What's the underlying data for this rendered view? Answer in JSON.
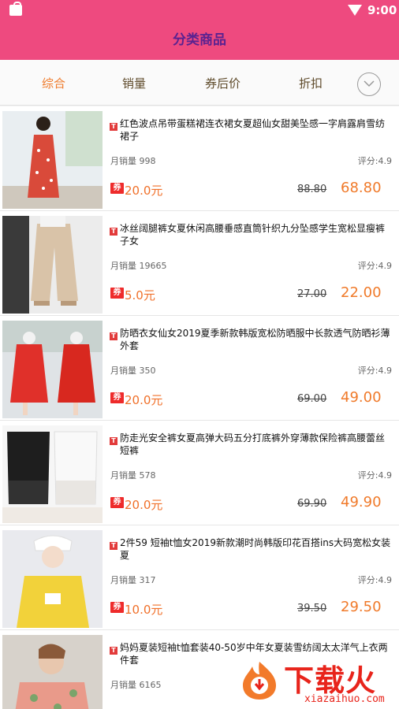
{
  "status_bar": {
    "time": "9:00"
  },
  "header": {
    "title": "分类商品"
  },
  "tabs": [
    {
      "label": "综合",
      "active": true
    },
    {
      "label": "销量",
      "active": false
    },
    {
      "label": "券后价",
      "active": false
    },
    {
      "label": "折扣",
      "active": false
    }
  ],
  "products": [
    {
      "name": "红色波点吊带蛋糕裙连衣裙女夏超仙女甜美坠感一字肩露肩雪纺裙子",
      "sales": "月销量 998",
      "rating": "评分:4.9",
      "coupon": "20.0元",
      "original_price": "88.80",
      "final_price": "68.80"
    },
    {
      "name": "冰丝阔腿裤女夏休闲高腰垂感直筒针织九分坠感学生宽松显瘦裤子女",
      "sales": "月销量 19665",
      "rating": "评分:4.9",
      "coupon": "5.0元",
      "original_price": "27.00",
      "final_price": "22.00"
    },
    {
      "name": "防晒衣女仙女2019夏季新款韩版宽松防晒服中长款透气防晒衫薄外套",
      "sales": "月销量 350",
      "rating": "评分:4.9",
      "coupon": "20.0元",
      "original_price": "69.00",
      "final_price": "49.00"
    },
    {
      "name": "防走光安全裤女夏高弹大码五分打底裤外穿薄款保险裤高腰蕾丝短裤",
      "sales": "月销量 578",
      "rating": "评分:4.9",
      "coupon": "20.0元",
      "original_price": "69.90",
      "final_price": "49.90"
    },
    {
      "name": "2件59 短袖t恤女2019新款潮时尚韩版印花百搭ins大码宽松女装夏",
      "sales": "月销量 317",
      "rating": "评分:4.9",
      "coupon": "10.0元",
      "original_price": "39.50",
      "final_price": "29.50"
    },
    {
      "name": "妈妈夏装短袖t恤套装40-50岁中年女夏装雪纺阔太太洋气上衣两件套",
      "sales": "月销量 6165",
      "rating": "",
      "coupon": "",
      "original_price": "",
      "final_price": ""
    }
  ],
  "labels": {
    "tmall_badge": "T",
    "coupon_badge": "券"
  },
  "watermark": {
    "brand": "下载火",
    "domain": "xiazaihuo.com"
  },
  "colors": {
    "header": "#ee4a7f",
    "title": "#5a2290",
    "accent_orange": "#f07a2a",
    "coupon_red": "#ee2b2b"
  }
}
